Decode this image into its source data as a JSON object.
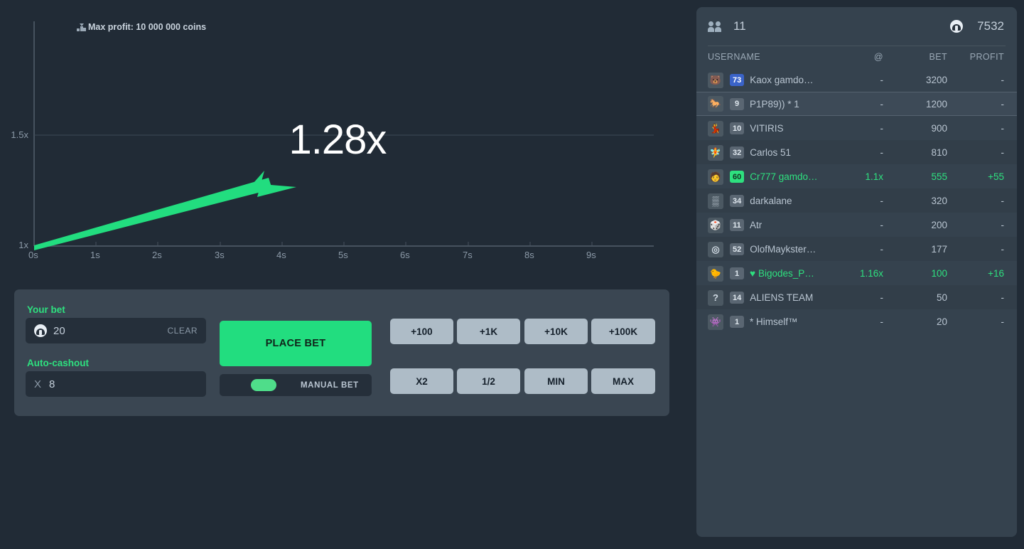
{
  "game": {
    "max_profit_label": "Max profit: 10 000 000 coins",
    "multiplier": "1.28x",
    "y_ticks": [
      "1.5x",
      "1x"
    ],
    "x_ticks": [
      "0s",
      "1s",
      "2s",
      "3s",
      "4s",
      "5s",
      "6s",
      "7s",
      "8s",
      "9s"
    ],
    "curve_color": "#22dd7f"
  },
  "bet_panel": {
    "your_bet_label": "Your bet",
    "bet_value": "20",
    "clear_label": "CLEAR",
    "autocashout_label": "Auto-cashout",
    "autocashout_prefix": "X",
    "autocashout_value": "8",
    "place_bet_label": "PLACE BET",
    "manual_bet_label": "MANUAL BET",
    "quick_add": [
      "+100",
      "+1K",
      "+10K",
      "+100K"
    ],
    "quick_mod": [
      "X2",
      "1/2",
      "MIN",
      "MAX"
    ]
  },
  "players": {
    "online_count": "11",
    "balance": "7532",
    "columns": {
      "username": "USERNAME",
      "at": "@",
      "bet": "BET",
      "profit": "PROFIT"
    },
    "rows": [
      {
        "level": "73",
        "name": "Kaox gamdo…",
        "at": "-",
        "bet": "3200",
        "profit": "-",
        "state": "betting",
        "badge": "blue",
        "avatar": "🐻"
      },
      {
        "level": "9",
        "name": "P1P89)) * 1",
        "at": "-",
        "bet": "1200",
        "profit": "-",
        "state": "me",
        "badge": "grey",
        "avatar": "🐎"
      },
      {
        "level": "10",
        "name": "VITIRIS",
        "at": "-",
        "bet": "900",
        "profit": "-",
        "state": "betting",
        "badge": "grey",
        "avatar": "💃"
      },
      {
        "level": "32",
        "name": "Carlos 51",
        "at": "-",
        "bet": "810",
        "profit": "-",
        "state": "betting",
        "badge": "grey",
        "avatar": "🧚"
      },
      {
        "level": "60",
        "name": "Cr777 gamdo…",
        "at": "1.1x",
        "bet": "555",
        "profit": "+55",
        "state": "cashed",
        "badge": "green",
        "avatar": "🧑"
      },
      {
        "level": "34",
        "name": "darkalane",
        "at": "-",
        "bet": "320",
        "profit": "-",
        "state": "betting",
        "badge": "grey",
        "avatar": "▒"
      },
      {
        "level": "11",
        "name": "Atr",
        "at": "-",
        "bet": "200",
        "profit": "-",
        "state": "betting",
        "badge": "grey",
        "avatar": "🎲"
      },
      {
        "level": "52",
        "name": "OlofMaykster…",
        "at": "-",
        "bet": "177",
        "profit": "-",
        "state": "betting",
        "badge": "grey",
        "avatar": "◎"
      },
      {
        "level": "1",
        "name": "Bigodes_P…",
        "at": "1.16x",
        "bet": "100",
        "profit": "+16",
        "state": "cashed",
        "badge": "grey",
        "avatar": "🐤",
        "heart": "♥"
      },
      {
        "level": "14",
        "name": "ALIENS TEAM",
        "at": "-",
        "bet": "50",
        "profit": "-",
        "state": "betting",
        "badge": "grey",
        "avatar": "?"
      },
      {
        "level": "1",
        "name": "* Himself™",
        "at": "-",
        "bet": "20",
        "profit": "-",
        "state": "betting",
        "badge": "grey",
        "avatar": "👾"
      }
    ]
  }
}
